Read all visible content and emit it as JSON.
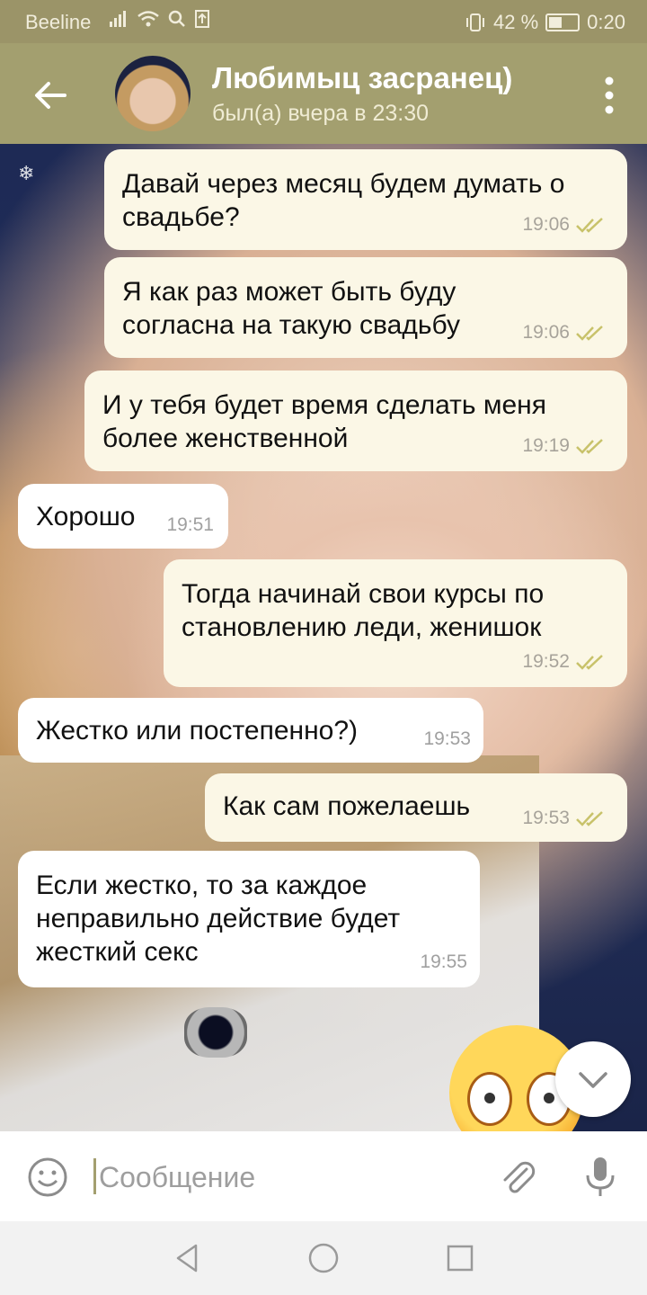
{
  "status_bar": {
    "carrier": "Beeline",
    "battery": "42 %",
    "time": "0:20",
    "colors": {
      "background": "#9b9468"
    }
  },
  "header": {
    "title": "Любимыц засранец)",
    "subtitle": "был(а) вчера в 23:30",
    "icons": {
      "back": "arrow-left-icon",
      "menu": "more-vertical-icon"
    },
    "colors": {
      "background": "#a39f6f"
    }
  },
  "messages": [
    {
      "dir": "out",
      "text": "Давай через месяц будем думать о свадьбе?",
      "time": "19:06",
      "read": true
    },
    {
      "dir": "out",
      "text": "Я как раз может быть буду согласна на такую свадьбу",
      "time": "19:06",
      "read": true
    },
    {
      "dir": "out",
      "text": "И у тебя будет время сделать меня более женственной",
      "time": "19:19",
      "read": true
    },
    {
      "dir": "in",
      "text": "Хорошо",
      "time": "19:51"
    },
    {
      "dir": "out",
      "text": "Тогда начинай свои курсы по становлению леди, женишок",
      "time": "19:52",
      "read": true
    },
    {
      "dir": "in",
      "text": "Жестко или постепенно?)",
      "time": "19:53"
    },
    {
      "dir": "out",
      "text": "Как сам пожелаешь",
      "time": "19:53",
      "read": true
    },
    {
      "dir": "in",
      "text": "Если жестко, то за каждое неправильно действие будет жесткий секс",
      "time": "19:55"
    }
  ],
  "input": {
    "placeholder": "Сообщение",
    "icons": {
      "emoji": "emoji-smile-icon",
      "attach": "paperclip-icon",
      "mic": "microphone-icon"
    }
  },
  "scroll_button": {
    "icon": "chevron-down-icon"
  },
  "nav_bar": {
    "icons": [
      "nav-back-icon",
      "nav-home-icon",
      "nav-recent-icon"
    ]
  },
  "colors": {
    "outgoing_bubble": "#fbf7e6",
    "incoming_bubble": "#ffffff",
    "read_check": "#c8c26a"
  }
}
